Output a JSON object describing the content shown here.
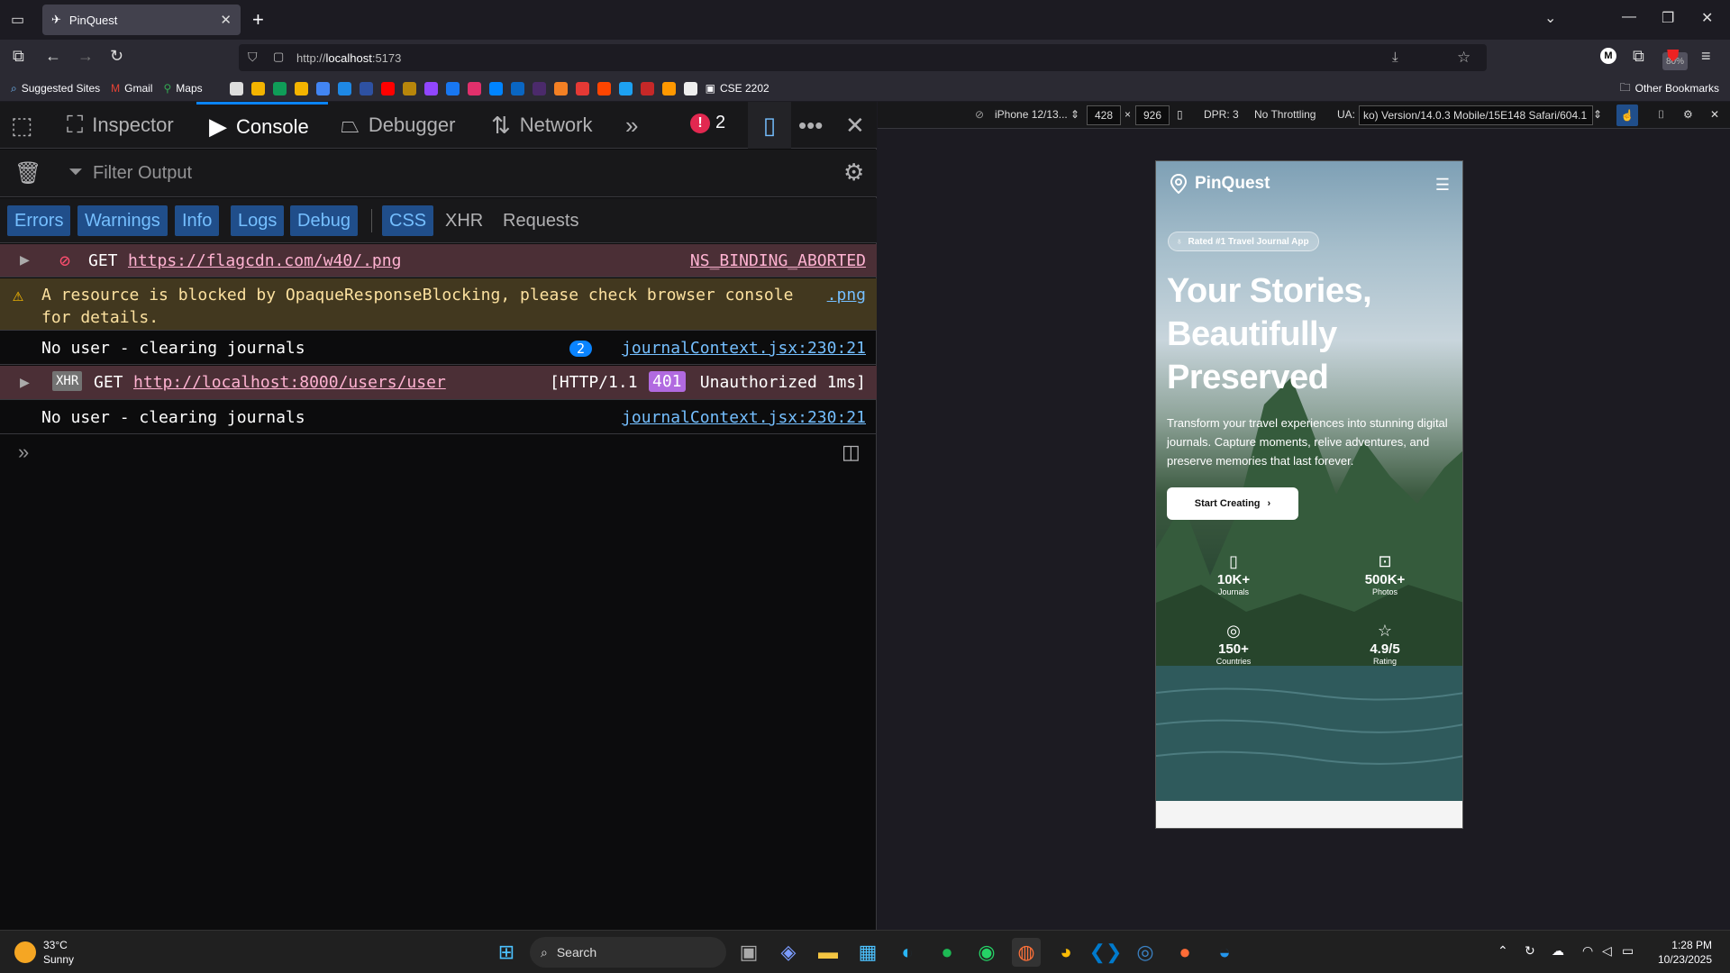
{
  "browser": {
    "tab_title": "PinQuest",
    "url_prefix": "http://",
    "url_host": "localhost",
    "url_port": ":5173",
    "zoom": "80%",
    "bookmarks": [
      {
        "label": "Suggested Sites",
        "icon": "compass-icon"
      },
      {
        "label": "Gmail",
        "icon": "gmail-icon"
      },
      {
        "label": "Maps",
        "icon": "maps-icon"
      }
    ],
    "bookmark_folder_cse": "CSE 2202",
    "other_bookmarks": "Other Bookmarks"
  },
  "devtools": {
    "tabs": {
      "inspector": "Inspector",
      "console": "Console",
      "debugger": "Debugger",
      "network": "Network"
    },
    "error_count": "2",
    "filter_placeholder": "Filter Output",
    "levels": [
      "Errors",
      "Warnings",
      "Info",
      "Logs",
      "Debug"
    ],
    "types": [
      "CSS",
      "XHR",
      "Requests"
    ],
    "messages": {
      "m1_method": "GET",
      "m1_url": "https://flagcdn.com/w40/.png",
      "m1_status": "NS_BINDING_ABORTED",
      "m2_text": "A resource is blocked by OpaqueResponseBlocking, please check browser console",
      "m2_text2": "for details.",
      "m2_link": ".png",
      "m3_text": "No user - clearing journals",
      "m3_count": "2",
      "m3_source": "journalContext.jsx:230:21",
      "m4_tag": "XHR",
      "m4_method": "GET",
      "m4_url": "http://localhost:8000/users/user",
      "m4_status_a": "[HTTP/1.1",
      "m4_code": "401",
      "m4_status_b": "Unauthorized 1ms]",
      "m5_text": "No user - clearing journals",
      "m5_source": "journalContext.jsx:230:21"
    }
  },
  "rdm": {
    "device": "iPhone 12/13...",
    "width": "428",
    "height": "926",
    "dpr": "DPR: 3",
    "throttling": "No Throttling",
    "ua_label": "UA:",
    "ua_value": "ko) Version/14.0.3 Mobile/15E148 Safari/604.1"
  },
  "app": {
    "brand": "PinQuest",
    "pill": "Rated #1 Travel Journal App",
    "headline_1": "Your Stories,",
    "headline_2": "Beautifully",
    "headline_3": "Preserved",
    "subtitle": "Transform your travel experiences into stunning digital journals. Capture moments, relive adventures, and preserve memories that last forever.",
    "cta": "Start Creating",
    "stats": [
      {
        "value": "10K+",
        "label": "Journals",
        "icon": "book-icon"
      },
      {
        "value": "500K+",
        "label": "Photos",
        "icon": "image-icon"
      },
      {
        "value": "150+",
        "label": "Countries",
        "icon": "globe-icon"
      },
      {
        "value": "4.9/5",
        "label": "Rating",
        "icon": "star-icon"
      }
    ]
  },
  "taskbar": {
    "temp": "33°C",
    "condition": "Sunny",
    "search": "Search",
    "time": "1:28 PM",
    "date": "10/23/2025"
  }
}
